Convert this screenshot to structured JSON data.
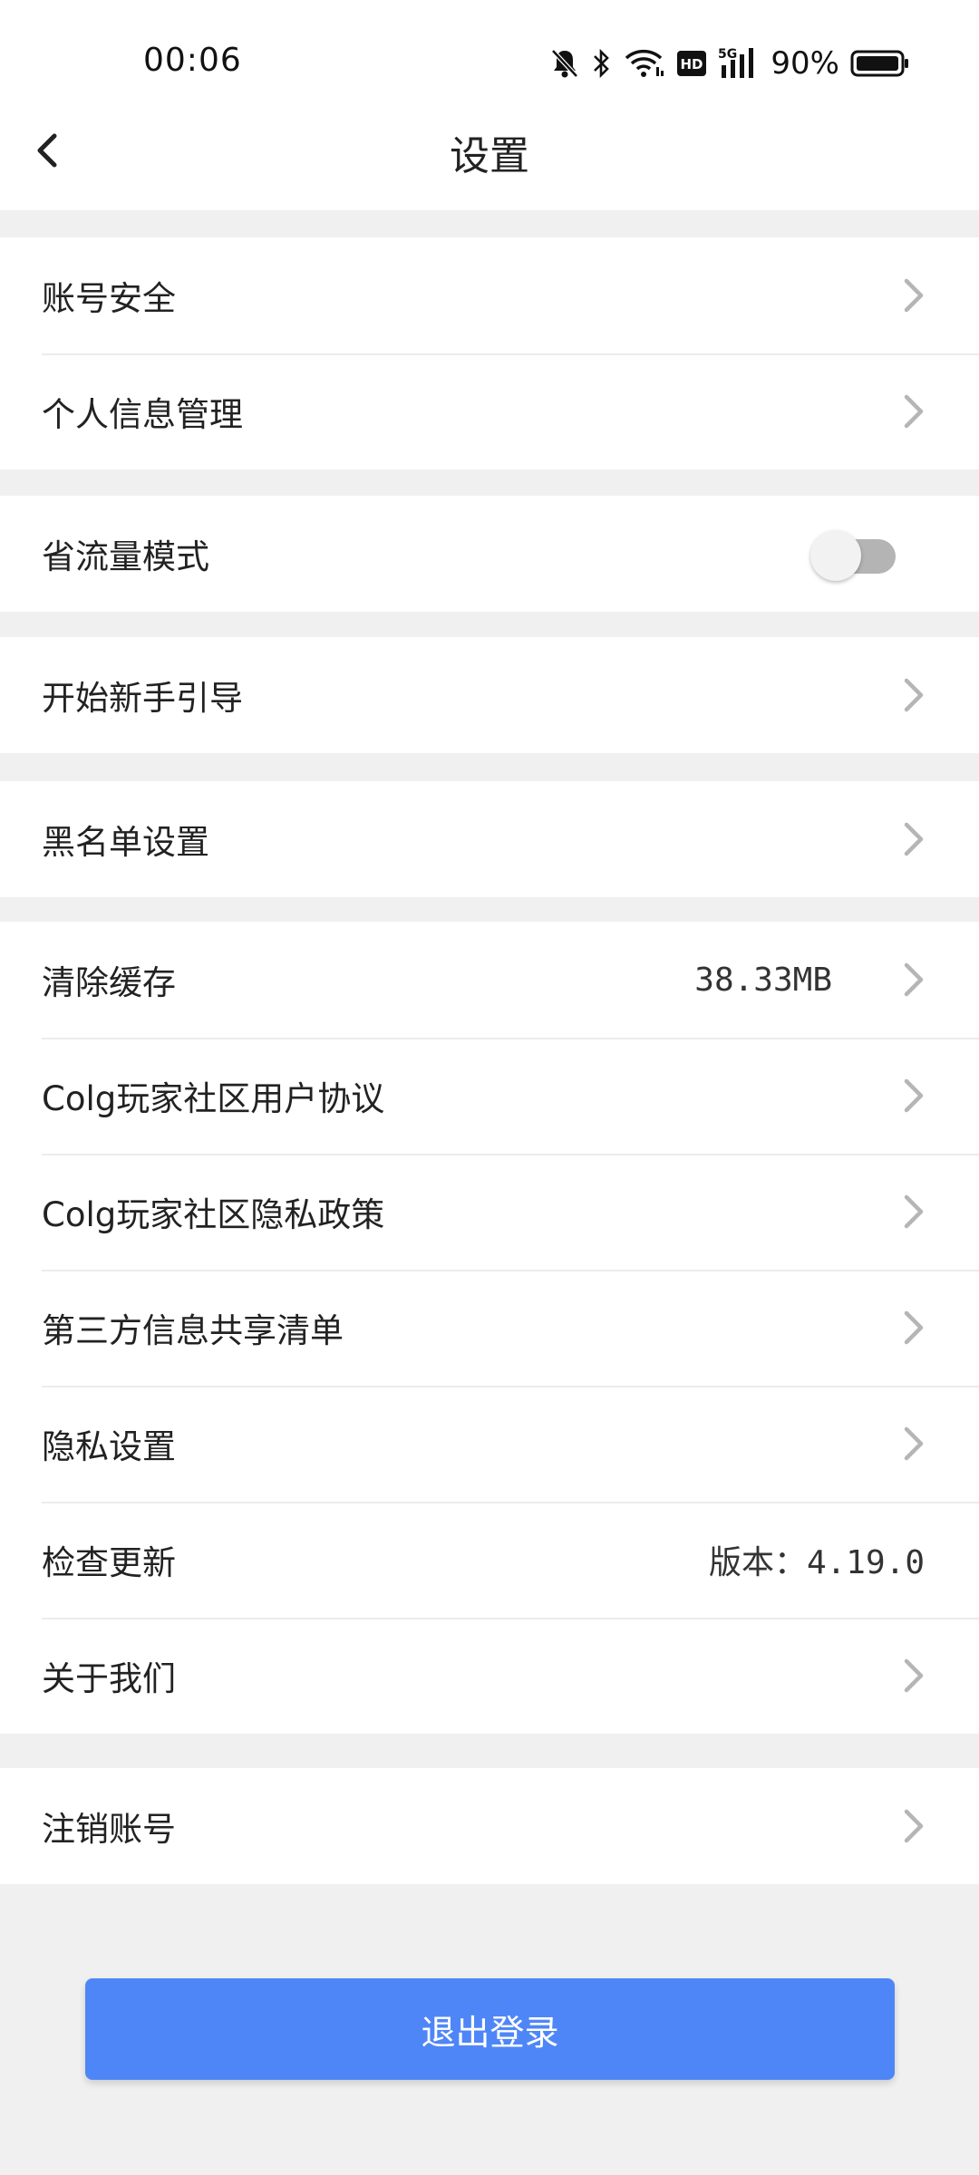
{
  "status_bar": {
    "time": "00:06",
    "battery": "90%",
    "icons": [
      "mute-bell-icon",
      "bluetooth-icon",
      "wifi-icon",
      "hd-icon",
      "5g-signal-icon",
      "battery-icon"
    ]
  },
  "header": {
    "title": "设置",
    "back_icon": "chevron-left-icon"
  },
  "groups": {
    "account": [
      {
        "label": "账号安全"
      },
      {
        "label": "个人信息管理"
      }
    ],
    "data_saver": {
      "label": "省流量模式",
      "enabled": false
    },
    "guide": {
      "label": "开始新手引导"
    },
    "blacklist": {
      "label": "黑名单设置"
    },
    "misc": [
      {
        "label": "清除缓存",
        "value": "38.33MB"
      },
      {
        "label": "Colg玩家社区用户协议"
      },
      {
        "label": "Colg玩家社区隐私政策"
      },
      {
        "label": "第三方信息共享清单"
      },
      {
        "label": "隐私设置"
      },
      {
        "label": "检查更新",
        "value": "版本：4.19.0"
      },
      {
        "label": "关于我们"
      }
    ],
    "cancel_account": {
      "label": "注销账号"
    }
  },
  "logout_label": "退出登录",
  "colors": {
    "accent": "#4f86f7",
    "background": "#f0f0f0",
    "chevron": "#b5b5b5"
  }
}
